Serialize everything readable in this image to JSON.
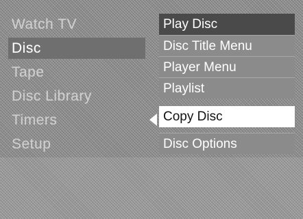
{
  "main_menu": {
    "items": [
      {
        "label": "Watch TV"
      },
      {
        "label": "Disc"
      },
      {
        "label": "Tape"
      },
      {
        "label": "Disc Library"
      },
      {
        "label": "Timers"
      },
      {
        "label": "Setup"
      }
    ],
    "selected": "Disc"
  },
  "sub_menu": {
    "items": [
      {
        "label": "Play Disc"
      },
      {
        "label": "Disc Title Menu"
      },
      {
        "label": "Player Menu"
      },
      {
        "label": "Playlist"
      },
      {
        "label": "Copy Disc"
      },
      {
        "label": "Disc Options"
      }
    ],
    "highlighted": "Copy Disc"
  },
  "colors": {
    "background": "#8a8a8a",
    "active_main": "#6f6f6f",
    "sub_top": "#4a4a4a",
    "sub_item": "#8b8b8b",
    "highlight": "#ffffff"
  }
}
